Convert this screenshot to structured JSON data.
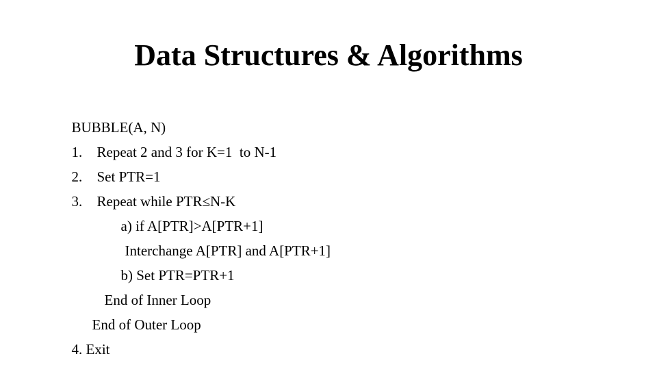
{
  "slide": {
    "title": "Data Structures & Algorithms",
    "lines": [
      {
        "num": "",
        "text": "BUBBLE(A, N)"
      },
      {
        "num": "1.",
        "text": "Repeat 2 and 3 for K=1  to N-1"
      },
      {
        "num": "2.",
        "text": "Set PTR=1"
      },
      {
        "num": "3.",
        "text": "Repeat while PTR≤N-K"
      },
      {
        "num": "",
        "text": "a) if A[PTR]>A[PTR+1]"
      },
      {
        "num": "",
        "text": "Interchange A[PTR] and A[PTR+1]"
      },
      {
        "num": "",
        "text": "b) Set PTR=PTR+1"
      },
      {
        "num": "",
        "text": "End of Inner Loop"
      },
      {
        "num": "",
        "text": "End of Outer Loop"
      },
      {
        "num": "",
        "text": "4. Exit"
      }
    ]
  }
}
